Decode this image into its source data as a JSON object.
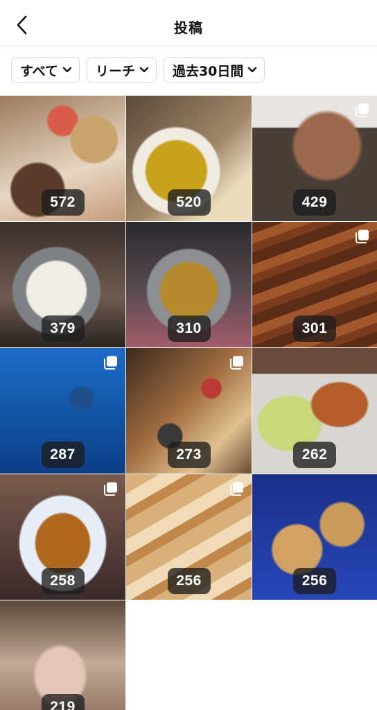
{
  "header": {
    "title": "投稿"
  },
  "filters": [
    {
      "label": "すべて"
    },
    {
      "label": "リーチ"
    },
    {
      "label": "過去30日間"
    }
  ],
  "posts": [
    {
      "count": "572",
      "multi": false
    },
    {
      "count": "520",
      "multi": false
    },
    {
      "count": "429",
      "multi": true
    },
    {
      "count": "379",
      "multi": false
    },
    {
      "count": "310",
      "multi": false
    },
    {
      "count": "301",
      "multi": true
    },
    {
      "count": "287",
      "multi": true
    },
    {
      "count": "273",
      "multi": true
    },
    {
      "count": "262",
      "multi": false
    },
    {
      "count": "258",
      "multi": true
    },
    {
      "count": "256",
      "multi": true
    },
    {
      "count": "256",
      "multi": false
    },
    {
      "count": "219",
      "multi": false
    }
  ],
  "icons": {
    "back": "chevron-left-icon",
    "dropdown": "chevron-down-icon",
    "multi": "carousel-icon"
  }
}
